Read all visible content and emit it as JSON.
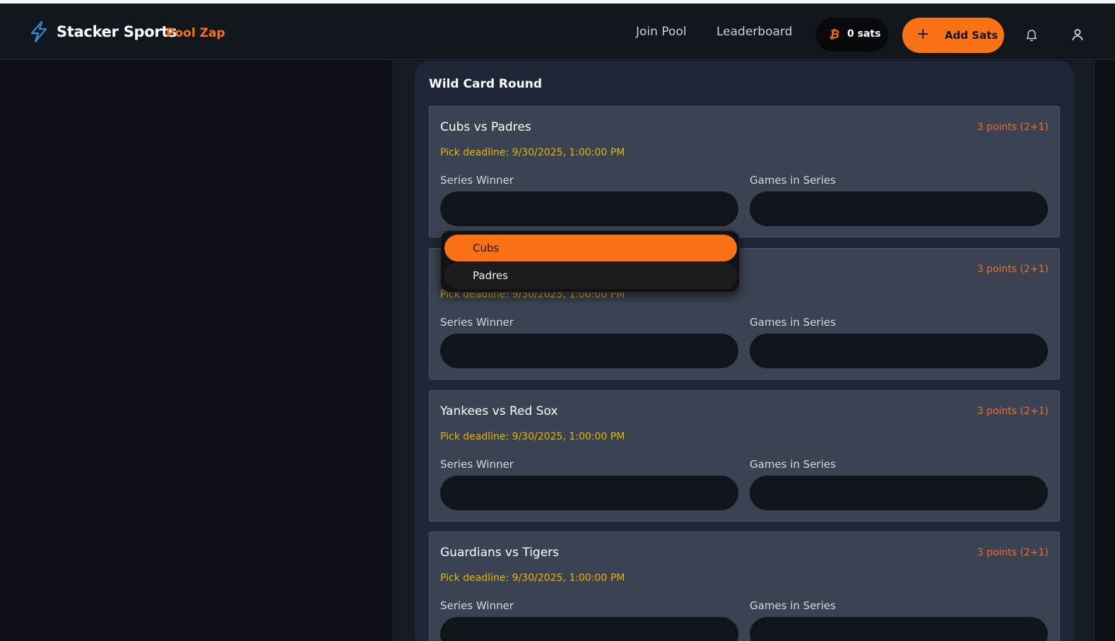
{
  "header": {
    "brand": "Stacker Sports",
    "brand_sub": "Pool Zap",
    "nav": [
      "Join Pool",
      "Leaderboard"
    ],
    "balance": "0 sats",
    "add_sats_label": "Add Sats",
    "icons": [
      "lightning-icon",
      "bitcoin-icon",
      "plus-icon",
      "bell-icon",
      "user-icon"
    ]
  },
  "round": {
    "title": "Wild Card Round",
    "series_winner_label": "Series Winner",
    "games_in_series_label": "Games in Series",
    "matches": [
      {
        "title": "Cubs vs Padres",
        "points": "3 points (2+1)",
        "deadline": "Pick deadline: 9/30/2025, 1:00:00 PM"
      },
      {
        "title": "",
        "points": "3 points (2+1)",
        "deadline": "Pick deadline: 9/30/2025, 1:00:00 PM"
      },
      {
        "title": "Yankees vs Red Sox",
        "points": "3 points (2+1)",
        "deadline": "Pick deadline: 9/30/2025, 1:00:00 PM"
      },
      {
        "title": "Guardians vs Tigers",
        "points": "3 points (2+1)",
        "deadline": "Pick deadline: 9/30/2025, 1:00:00 PM"
      }
    ]
  },
  "dropdown": {
    "options": [
      "Cubs",
      "Padres"
    ],
    "highlighted": "Cubs"
  },
  "colors": {
    "accent": "#f97316",
    "deadline": "#eab308",
    "points": "#f06b2e",
    "card": "#394352"
  }
}
